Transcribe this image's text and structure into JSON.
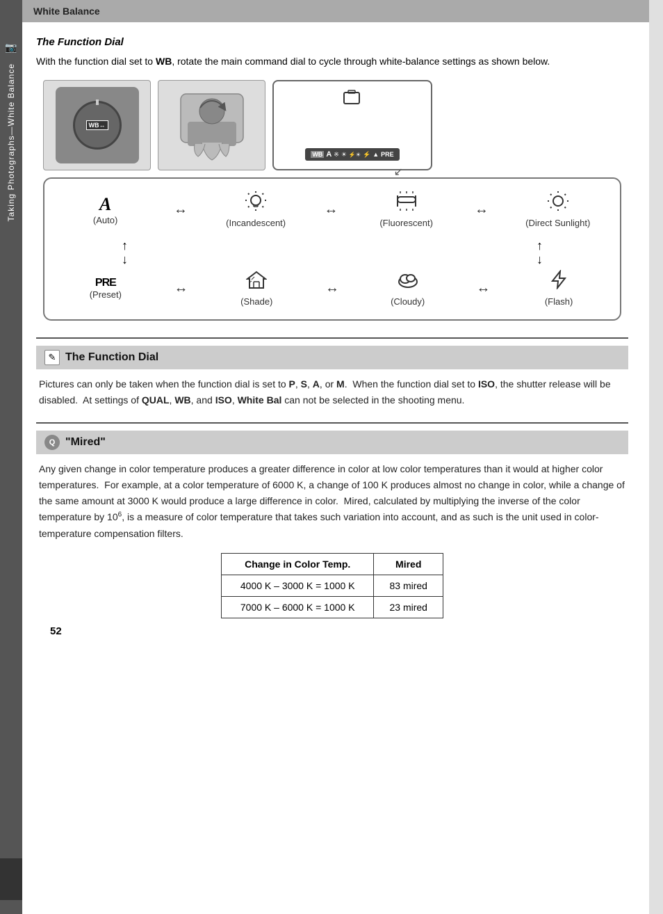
{
  "header": {
    "title": "White Balance"
  },
  "side_tab": {
    "text": "Taking Photographs—White Balance"
  },
  "function_dial_section": {
    "title": "The Function Dial",
    "intro": "With the function dial set to WB, rotate the main command dial to cycle through white-balance settings as shown below.",
    "intro_bold": "WB"
  },
  "wb_cycle": {
    "row1": [
      {
        "icon": "A",
        "label": "(Auto)",
        "type": "text"
      },
      {
        "icon": "☀",
        "label": "(Incandescent)",
        "type": "unicode"
      },
      {
        "icon": "⚡☀",
        "label": "(Fluorescent)",
        "type": "unicode"
      },
      {
        "icon": "☀",
        "label": "(Direct Sunlight)",
        "type": "unicode"
      }
    ],
    "row2": [
      {
        "icon": "PRE",
        "label": "(Preset)",
        "type": "text"
      },
      {
        "icon": "⛠",
        "label": "(Shade)",
        "type": "unicode"
      },
      {
        "icon": "☁",
        "label": "(Cloudy)",
        "type": "unicode"
      },
      {
        "icon": "⚡",
        "label": "(Flash)",
        "type": "unicode"
      }
    ]
  },
  "note_section": {
    "icon": "✎",
    "title": "The Function Dial",
    "body": "Pictures can only be taken when the function dial is set to P, S, A, or M.  When the function dial set to ISO, the shutter release will be disabled.  At settings of QUAL, WB, and ISO, White Bal can not be selected in the shooting menu."
  },
  "mired_section": {
    "icon": "Q",
    "title": "\"Mired\"",
    "body": "Any given change in color temperature produces a greater difference in color at low color temperatures than it would at higher color temperatures.  For example, at a color temperature of 6000 K, a change of 100 K produces almost no change in color, while a change of the same amount at 3000 K would produce a large difference in color.  Mired, calculated by multiplying the inverse of the color temperature by 10 6, is a measure of color temperature that takes such variation into account, and as such is the unit used in color-temperature compensation filters.",
    "table": {
      "headers": [
        "Change in Color Temp.",
        "Mired"
      ],
      "rows": [
        [
          "4000 K – 3000 K = 1000 K",
          "83 mired"
        ],
        [
          "7000 K – 6000 K = 1000 K",
          "23 mired"
        ]
      ]
    }
  },
  "page_number": "52",
  "lcd_display": {
    "top_icon": "□",
    "bottom_text": "WB A ※ ☀ ☀ ⚡ ▲ PRE"
  }
}
